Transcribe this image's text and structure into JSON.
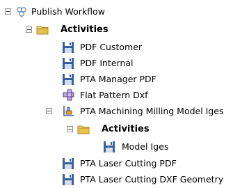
{
  "tree": {
    "root": {
      "label": "Publish Workflow",
      "icon": "workflow-icon",
      "expanded": true
    },
    "activities": {
      "label": "Activities",
      "icon": "folder-icon",
      "expanded": true
    },
    "items": [
      {
        "label": "PDF Customer",
        "icon": "save-icon"
      },
      {
        "label": "PDF Internal",
        "icon": "save-icon"
      },
      {
        "label": "PTA Manager PDF",
        "icon": "save-icon"
      },
      {
        "label": "Flat Pattern Dxf",
        "icon": "flat-pattern-icon"
      },
      {
        "label": "PTA Machining Milling Model Iges",
        "icon": "machining-icon",
        "expanded": true
      },
      {
        "label": "PTA Laser Cutting PDF",
        "icon": "save-icon"
      },
      {
        "label": "PTA Laser Cutting DXF Geometry",
        "icon": "save-icon"
      }
    ],
    "sub_activities": {
      "label": "Activities",
      "icon": "folder-icon",
      "expanded": true
    },
    "sub_items": [
      {
        "label": "Model Iges",
        "icon": "save-icon"
      }
    ]
  },
  "colors": {
    "save_icon": "#3a5fa0",
    "folder_icon": "#e8c14a",
    "tree_toggle_border": "#8c8c8c"
  }
}
